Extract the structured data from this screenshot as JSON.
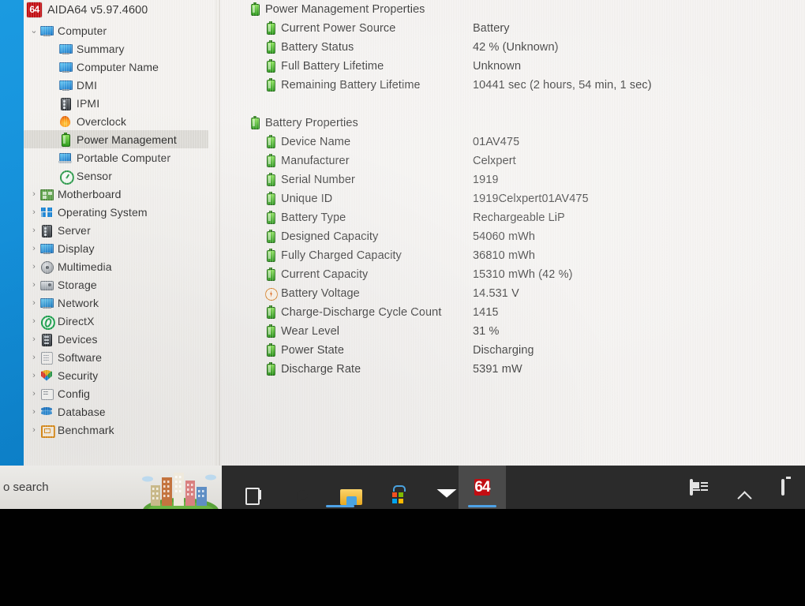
{
  "app": {
    "logo": "64",
    "title": "AIDA64 v5.97.4600"
  },
  "sidebar": {
    "items": [
      {
        "label": "Computer",
        "icon": "monitor-icon",
        "twisty": "⌄",
        "level": 1,
        "selected": false
      },
      {
        "label": "Summary",
        "icon": "monitor-icon",
        "twisty": "",
        "level": 2,
        "selected": false
      },
      {
        "label": "Computer Name",
        "icon": "monitor-icon",
        "twisty": "",
        "level": 2,
        "selected": false
      },
      {
        "label": "DMI",
        "icon": "monitor-icon",
        "twisty": "",
        "level": 2,
        "selected": false
      },
      {
        "label": "IPMI",
        "icon": "server-icon",
        "twisty": "",
        "level": 2,
        "selected": false
      },
      {
        "label": "Overclock",
        "icon": "flame-icon",
        "twisty": "",
        "level": 2,
        "selected": false
      },
      {
        "label": "Power Management",
        "icon": "battery-icon",
        "twisty": "",
        "level": 2,
        "selected": true
      },
      {
        "label": "Portable Computer",
        "icon": "laptop-icon",
        "twisty": "",
        "level": 2,
        "selected": false
      },
      {
        "label": "Sensor",
        "icon": "sensor-icon",
        "twisty": "",
        "level": 2,
        "selected": false
      },
      {
        "label": "Motherboard",
        "icon": "motherboard-icon",
        "twisty": "›",
        "level": 1,
        "selected": false
      },
      {
        "label": "Operating System",
        "icon": "windows-icon",
        "twisty": "›",
        "level": 1,
        "selected": false
      },
      {
        "label": "Server",
        "icon": "server-icon",
        "twisty": "›",
        "level": 1,
        "selected": false
      },
      {
        "label": "Display",
        "icon": "monitor-icon",
        "twisty": "›",
        "level": 1,
        "selected": false
      },
      {
        "label": "Multimedia",
        "icon": "multimedia-icon",
        "twisty": "›",
        "level": 1,
        "selected": false
      },
      {
        "label": "Storage",
        "icon": "storage-icon",
        "twisty": "›",
        "level": 1,
        "selected": false
      },
      {
        "label": "Network",
        "icon": "network-icon",
        "twisty": "›",
        "level": 1,
        "selected": false
      },
      {
        "label": "DirectX",
        "icon": "directx-icon",
        "twisty": "›",
        "level": 1,
        "selected": false
      },
      {
        "label": "Devices",
        "icon": "devices-icon",
        "twisty": "›",
        "level": 1,
        "selected": false
      },
      {
        "label": "Software",
        "icon": "software-icon",
        "twisty": "›",
        "level": 1,
        "selected": false
      },
      {
        "label": "Security",
        "icon": "shield-icon",
        "twisty": "›",
        "level": 1,
        "selected": false
      },
      {
        "label": "Config",
        "icon": "config-icon",
        "twisty": "›",
        "level": 1,
        "selected": false
      },
      {
        "label": "Database",
        "icon": "database-icon",
        "twisty": "›",
        "level": 1,
        "selected": false
      },
      {
        "label": "Benchmark",
        "icon": "benchmark-icon",
        "twisty": "›",
        "level": 1,
        "selected": false
      }
    ]
  },
  "content": {
    "sections": [
      {
        "header": "Power Management Properties",
        "header_icon": "battery-icon",
        "rows": [
          {
            "label": "Current Power Source",
            "value": "Battery",
            "icon": "battery-icon"
          },
          {
            "label": "Battery Status",
            "value": "42 % (Unknown)",
            "icon": "battery-icon"
          },
          {
            "label": "Full Battery Lifetime",
            "value": "Unknown",
            "icon": "battery-icon"
          },
          {
            "label": "Remaining Battery Lifetime",
            "value": "10441 sec  (2 hours, 54 min, 1 sec)",
            "icon": "battery-icon"
          }
        ]
      },
      {
        "header": "Battery Properties",
        "header_icon": "battery-icon",
        "rows": [
          {
            "label": "Device Name",
            "value": "01AV475",
            "icon": "battery-icon"
          },
          {
            "label": "Manufacturer",
            "value": "Celxpert",
            "icon": "battery-icon"
          },
          {
            "label": "Serial Number",
            "value": "1919",
            "icon": "battery-icon"
          },
          {
            "label": "Unique ID",
            "value": "1919Celxpert01AV475",
            "icon": "battery-icon"
          },
          {
            "label": "Battery Type",
            "value": "Rechargeable LiP",
            "icon": "battery-icon"
          },
          {
            "label": "Designed Capacity",
            "value": "54060 mWh",
            "icon": "battery-icon"
          },
          {
            "label": "Fully Charged Capacity",
            "value": "36810 mWh",
            "icon": "battery-icon"
          },
          {
            "label": "Current Capacity",
            "value": "15310 mWh  (42 %)",
            "icon": "battery-icon"
          },
          {
            "label": "Battery Voltage",
            "value": "14.531 V",
            "icon": "voltage-icon"
          },
          {
            "label": "Charge-Discharge Cycle Count",
            "value": "1415",
            "icon": "battery-icon"
          },
          {
            "label": "Wear Level",
            "value": "31 %",
            "icon": "battery-icon"
          },
          {
            "label": "Power State",
            "value": "Discharging",
            "icon": "battery-icon"
          },
          {
            "label": "Discharge Rate",
            "value": "5391 mW",
            "icon": "battery-icon"
          }
        ]
      }
    ]
  },
  "taskbar": {
    "search_text": "o search",
    "buttons": [
      {
        "name": "task-view",
        "icon": "task-view-icon",
        "active": false,
        "running": false
      },
      {
        "name": "edge",
        "icon": "edge-icon",
        "active": false,
        "running": false
      },
      {
        "name": "file-explorer",
        "icon": "folder-icon",
        "active": false,
        "running": true
      },
      {
        "name": "microsoft-store",
        "icon": "store-icon",
        "active": false,
        "running": false
      },
      {
        "name": "mail",
        "icon": "mail-icon",
        "active": false,
        "running": false
      },
      {
        "name": "aida64",
        "icon": "aida64-icon",
        "label": "64",
        "active": true,
        "running": true
      }
    ],
    "tray": [
      {
        "name": "news-and-interests",
        "icon": "news-icon"
      },
      {
        "name": "show-hidden-icons",
        "icon": "chevron-up-icon"
      },
      {
        "name": "battery-tray",
        "icon": "battery-tray-icon"
      }
    ]
  },
  "colors": {
    "accent_blue": "#1b9ae0",
    "aida_red": "#c20d12",
    "window_bg": "#f3f1ee",
    "taskbar_bg": "#2b2b2b",
    "selection": "#dcdad5"
  }
}
